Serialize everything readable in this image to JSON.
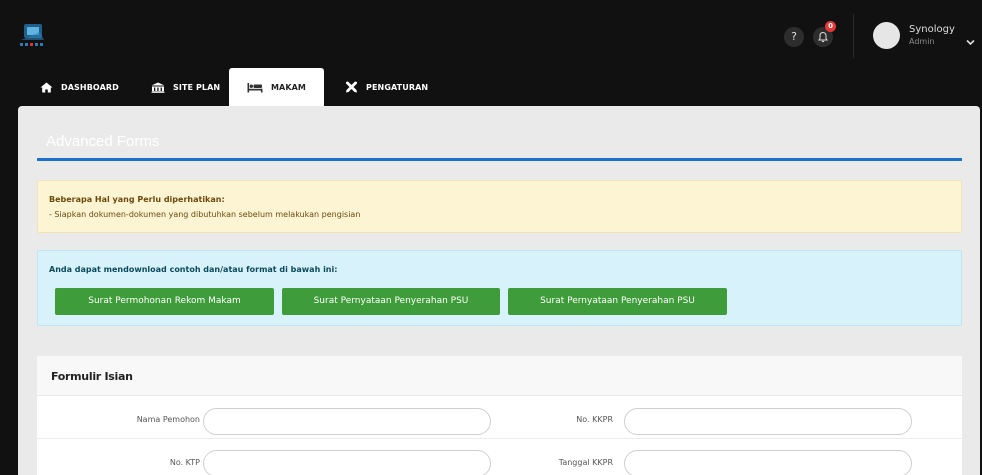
{
  "topbar": {
    "help_label": "?",
    "notif_count": "0",
    "user_name": "Synology",
    "user_role": "Admin"
  },
  "nav": {
    "items": [
      {
        "label": "DASHBOARD",
        "icon": "home-icon"
      },
      {
        "label": "SITE PLAN",
        "icon": "building-icon"
      },
      {
        "label": "MAKAM",
        "icon": "bed-icon",
        "active": true
      },
      {
        "label": "PENGATURAN",
        "icon": "tools-icon"
      }
    ]
  },
  "page": {
    "title": "Advanced Forms"
  },
  "alert_warning": {
    "heading": "Beberapa Hal yang Perlu diperhatikan:",
    "text": "- Siapkan dokumen-dokumen yang dibutuhkan sebelum melakukan pengisian"
  },
  "alert_info": {
    "heading": "Anda dapat mendownload contoh dan/atau format di bawah ini:",
    "buttons": [
      "Surat Permohonan Rekom Makam",
      "Surat Pernyataan Penyerahan PSU",
      "Surat Pernyataan Penyerahan PSU"
    ]
  },
  "form": {
    "title": "Formulir Isian",
    "fields": {
      "nama_pemohon": "Nama Pemohon",
      "no_kkpr": "No. KKPR",
      "no_ktp": "No. KTP",
      "tanggal_kkpr": "Tanggal KKPR"
    }
  },
  "colors": {
    "topbar_bg": "#111111",
    "accent_blue": "#1a73c8",
    "button_green": "#3f9c3a",
    "badge_red": "#e53935"
  }
}
